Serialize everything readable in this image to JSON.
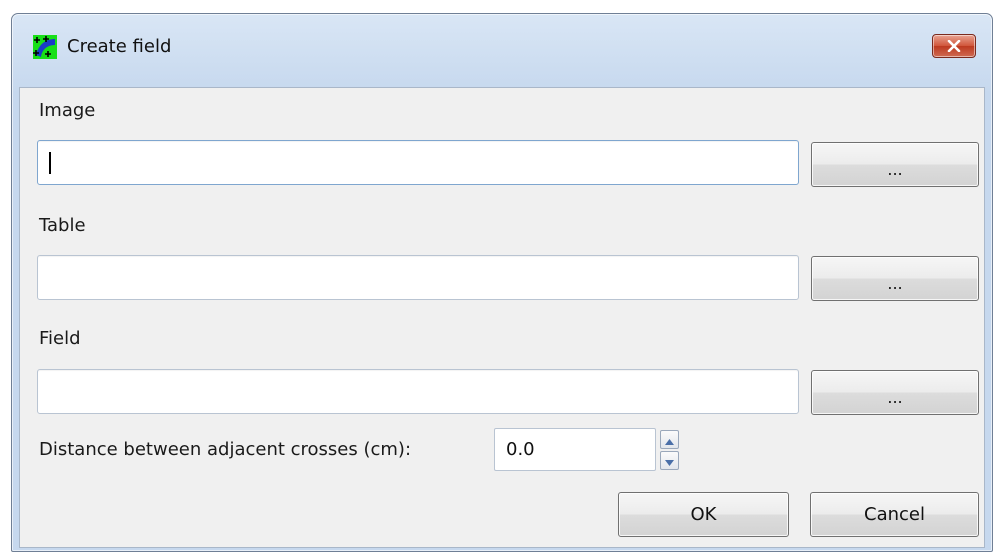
{
  "window": {
    "title": "Create field",
    "icon": "crosses-field-icon",
    "close_icon": "close-icon"
  },
  "image": {
    "label": "Image",
    "value": "",
    "browse_label": "..."
  },
  "table": {
    "label": "Table",
    "value": "",
    "browse_label": "..."
  },
  "field": {
    "label": "Field",
    "value": "",
    "browse_label": "..."
  },
  "distance": {
    "label": "Distance between adjacent crosses (cm):",
    "value": "0.0"
  },
  "buttons": {
    "ok": "OK",
    "cancel": "Cancel"
  },
  "colors": {
    "client_bg": "#f0f0f0",
    "title_gradient": "#c6d8ee",
    "close_red": "#c8452a",
    "icon_green": "#18e018",
    "icon_blue": "#1a3cc8"
  }
}
